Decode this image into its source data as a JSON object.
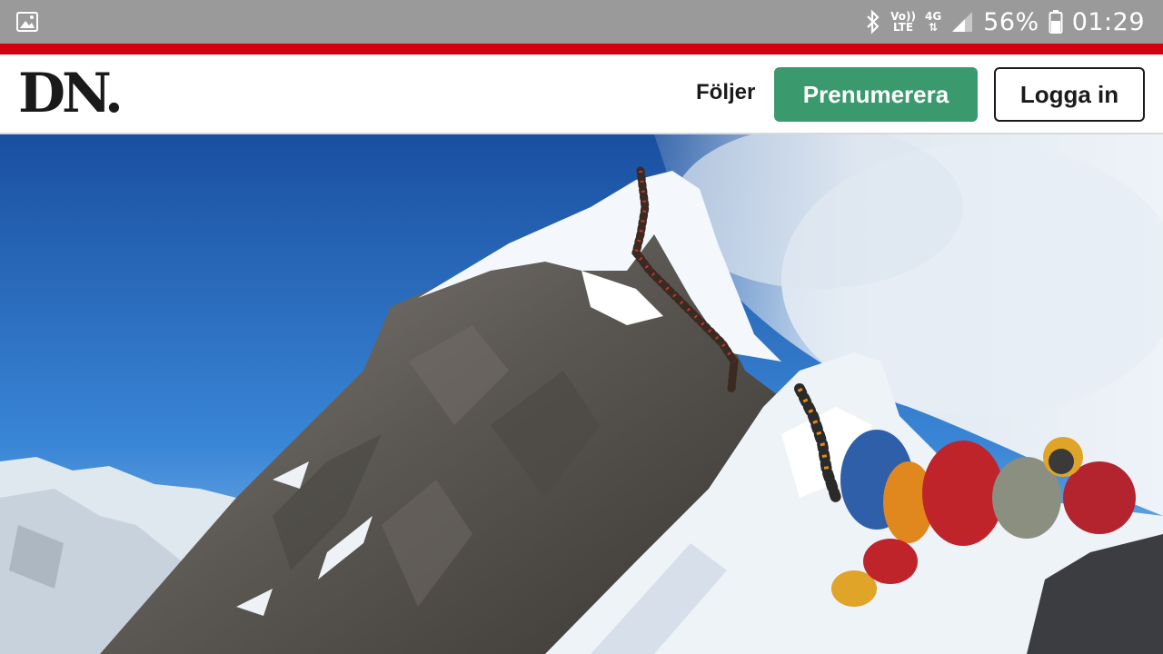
{
  "status_bar": {
    "battery": "56%",
    "time": "01:29",
    "volte_top": "Vo))",
    "volte_bottom": "LTE",
    "network": "4G",
    "icons": [
      "gallery-icon",
      "bluetooth-icon",
      "signal-icon",
      "battery-icon"
    ]
  },
  "header": {
    "logo": "DN.",
    "follow_label": "Följer",
    "subscribe_label": "Prenumerera",
    "login_label": "Logga in"
  },
  "colors": {
    "status_bar": "#9a9a9a",
    "brand_red": "#d4000f",
    "subscribe_green": "#3a9a6e",
    "sky_blue": "#1f5fb0"
  },
  "hero_image": {
    "depicts": "mountain-summit-climbers-queue"
  }
}
